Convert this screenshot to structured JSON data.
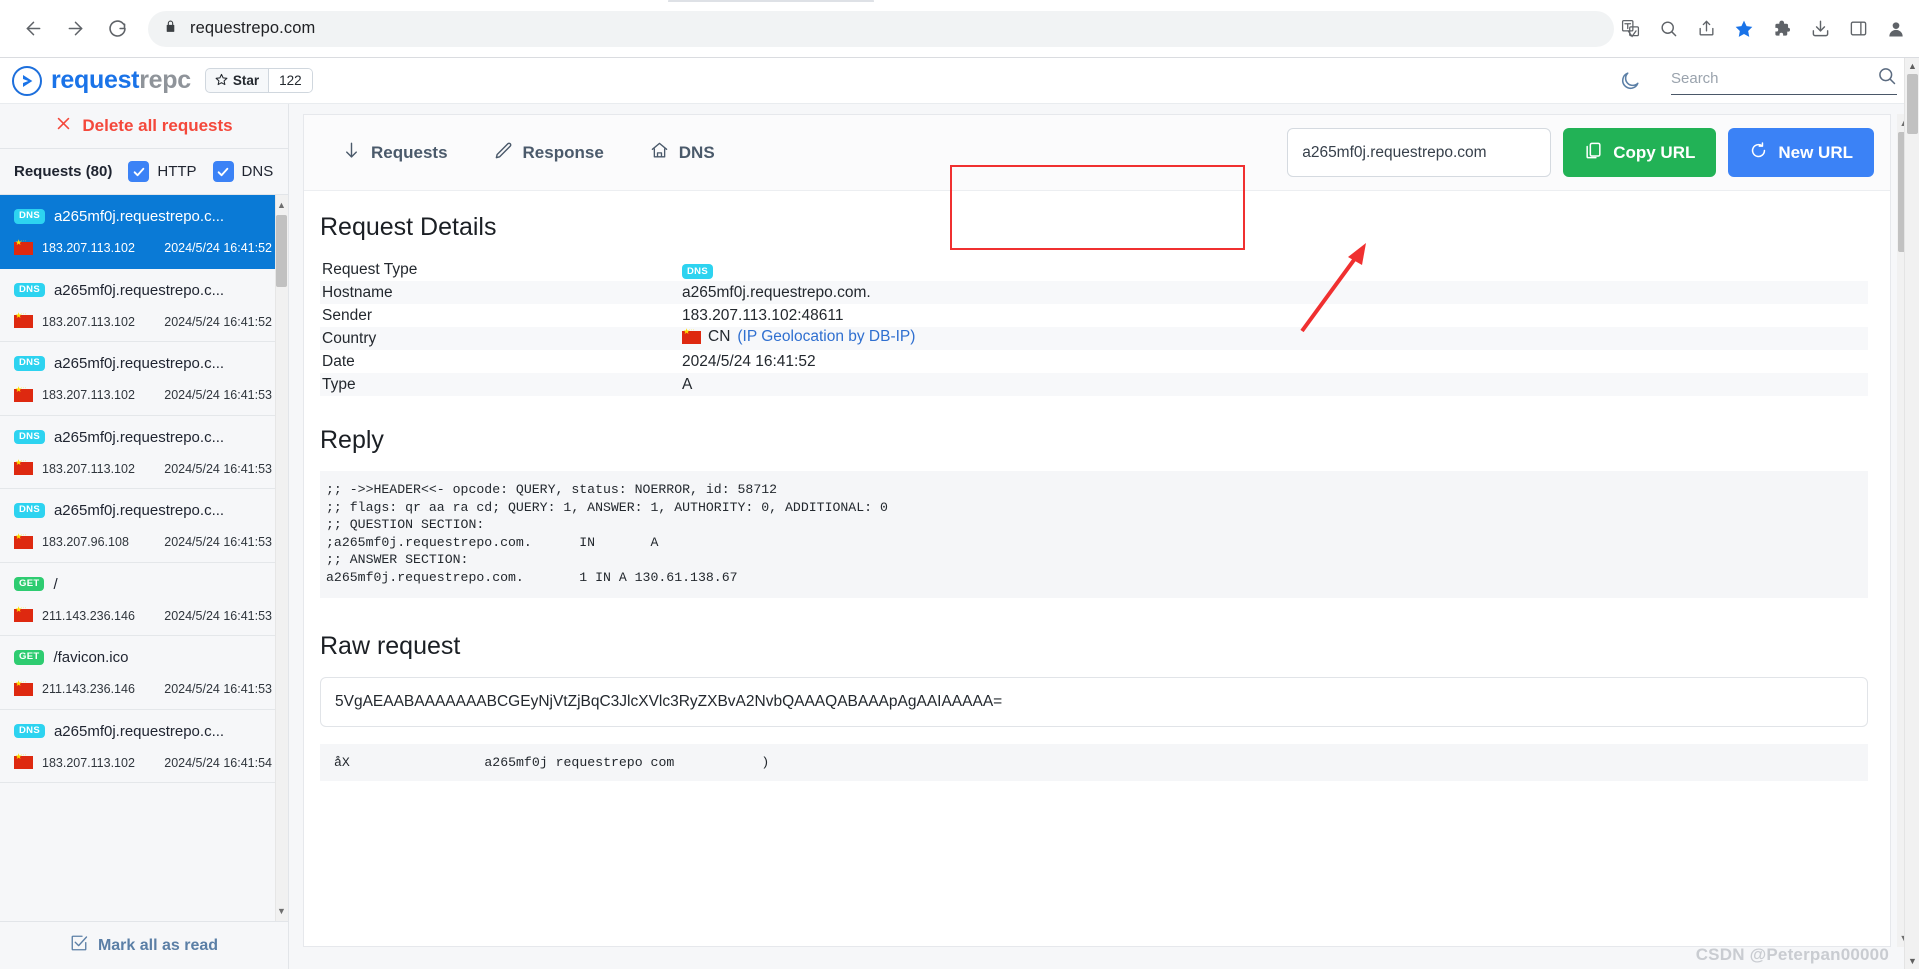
{
  "browser": {
    "url": "requestrepo.com",
    "back_icon": "back-arrow-icon",
    "forward_icon": "forward-arrow-icon",
    "reload_icon": "reload-icon",
    "lock_icon": "lock-icon",
    "icons": [
      "translate-icon",
      "zoom-icon",
      "share-icon",
      "bookmark-star-icon",
      "extensions-puzzle-icon",
      "downloads-icon",
      "side-panel-icon",
      "profile-icon",
      "menu-kebab-icon"
    ]
  },
  "header": {
    "brand_first": "request",
    "brand_second": "repc",
    "star_label": "Star",
    "star_count": "122",
    "theme_toggle_icon": "moon-icon",
    "search_placeholder": "Search",
    "search_value": "",
    "search_icon": "search-icon"
  },
  "sidebar": {
    "delete_all_label": "Delete all requests",
    "delete_all_icon": "close-x-icon",
    "requests_title": "Requests (80)",
    "filters": [
      {
        "label": "HTTP",
        "checked": true
      },
      {
        "label": "DNS",
        "checked": true
      }
    ],
    "mark_all_label": "Mark all as read",
    "mark_all_icon": "checkbox-check-icon",
    "items": [
      {
        "type": "DNS",
        "host": "a265mf0j.requestrepo.c...",
        "ip": "183.207.113.102",
        "time": "2024/5/24 16:41:52",
        "country": "CN",
        "selected": true
      },
      {
        "type": "DNS",
        "host": "a265mf0j.requestrepo.c...",
        "ip": "183.207.113.102",
        "time": "2024/5/24 16:41:52",
        "country": "CN",
        "selected": false
      },
      {
        "type": "DNS",
        "host": "a265mf0j.requestrepo.c...",
        "ip": "183.207.113.102",
        "time": "2024/5/24 16:41:53",
        "country": "CN",
        "selected": false
      },
      {
        "type": "DNS",
        "host": "a265mf0j.requestrepo.c...",
        "ip": "183.207.113.102",
        "time": "2024/5/24 16:41:53",
        "country": "CN",
        "selected": false
      },
      {
        "type": "DNS",
        "host": "a265mf0j.requestrepo.c...",
        "ip": "183.207.96.108",
        "time": "2024/5/24 16:41:53",
        "country": "CN",
        "selected": false
      },
      {
        "type": "GET",
        "host": "/",
        "ip": "211.143.236.146",
        "time": "2024/5/24 16:41:53",
        "country": "CN",
        "selected": false
      },
      {
        "type": "GET",
        "host": "/favicon.ico",
        "ip": "211.143.236.146",
        "time": "2024/5/24 16:41:53",
        "country": "CN",
        "selected": false
      },
      {
        "type": "DNS",
        "host": "a265mf0j.requestrepo.c...",
        "ip": "183.207.113.102",
        "time": "2024/5/24 16:41:54",
        "country": "CN",
        "selected": false
      }
    ]
  },
  "toolbar": {
    "tabs": [
      {
        "label": "Requests",
        "icon": "download-arrow-icon"
      },
      {
        "label": "Response",
        "icon": "pencil-edit-icon"
      },
      {
        "label": "DNS",
        "icon": "home-icon"
      }
    ],
    "url_value": "a265mf0j.requestrepo.com",
    "copy_url_label": "Copy URL",
    "copy_url_icon": "copy-clipboard-icon",
    "new_url_label": "New URL",
    "new_url_icon": "refresh-icon"
  },
  "details": {
    "title": "Request Details",
    "rows": [
      {
        "key": "Request Type",
        "value": "DNS",
        "is_badge": true
      },
      {
        "key": "Hostname",
        "value": "a265mf0j.requestrepo.com."
      },
      {
        "key": "Sender",
        "value": "183.207.113.102:48611"
      },
      {
        "key": "Country",
        "value": "CN",
        "link_text": "(IP Geolocation by DB-IP)",
        "has_flag": true
      },
      {
        "key": "Date",
        "value": "2024/5/24 16:41:52"
      },
      {
        "key": "Type",
        "value": "A"
      }
    ]
  },
  "reply": {
    "title": "Reply",
    "text": ";; ->>HEADER<<- opcode: QUERY, status: NOERROR, id: 58712\n;; flags: qr aa ra cd; QUERY: 1, ANSWER: 1, AUTHORITY: 0, ADDITIONAL: 0\n;; QUESTION SECTION:\n;a265mf0j.requestrepo.com.\tIN\t A\n;; ANSWER SECTION:\na265mf0j.requestrepo.com.\t1 IN A 130.61.138.67"
  },
  "raw": {
    "title": "Raw request",
    "base64": "5VgAEAABAAAAAAABCGEyNjVtZjBqC3JlcXVlc3RyZXBvA2NvbQAAAQABAAApAgAAIAAAAA=",
    "decoded": "åX                 a265mf0j requestrepo com           )"
  },
  "watermark": "CSDN @Peterpan00000"
}
